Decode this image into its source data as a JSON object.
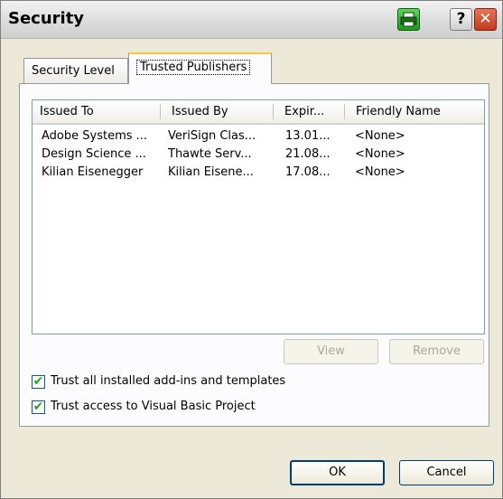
{
  "window": {
    "title": "Security"
  },
  "titlebar": {
    "help_glyph": "?",
    "close_glyph": "✕"
  },
  "tabs": [
    {
      "label": "Security Level",
      "active": false
    },
    {
      "label": "Trusted Publishers",
      "active": true
    }
  ],
  "table": {
    "columns": [
      "Issued To",
      "Issued By",
      "Expir...",
      "Friendly Name"
    ],
    "rows": [
      [
        "Adobe Systems ...",
        "VeriSign Clas...",
        "13.01...",
        "<None>"
      ],
      [
        "Design Science ...",
        "Thawte Serv...",
        "21.08...",
        "<None>"
      ],
      [
        "Kilian Eisenegger",
        "Kilian Eisene...",
        "17.08...",
        "<None>"
      ]
    ]
  },
  "buttons": {
    "view": "View",
    "remove": "Remove",
    "ok": "OK",
    "cancel": "Cancel"
  },
  "checkboxes": [
    {
      "label": "Trust all installed add-ins and templates",
      "checked": true
    },
    {
      "label": "Trust access to Visual Basic Project",
      "checked": true
    }
  ]
}
